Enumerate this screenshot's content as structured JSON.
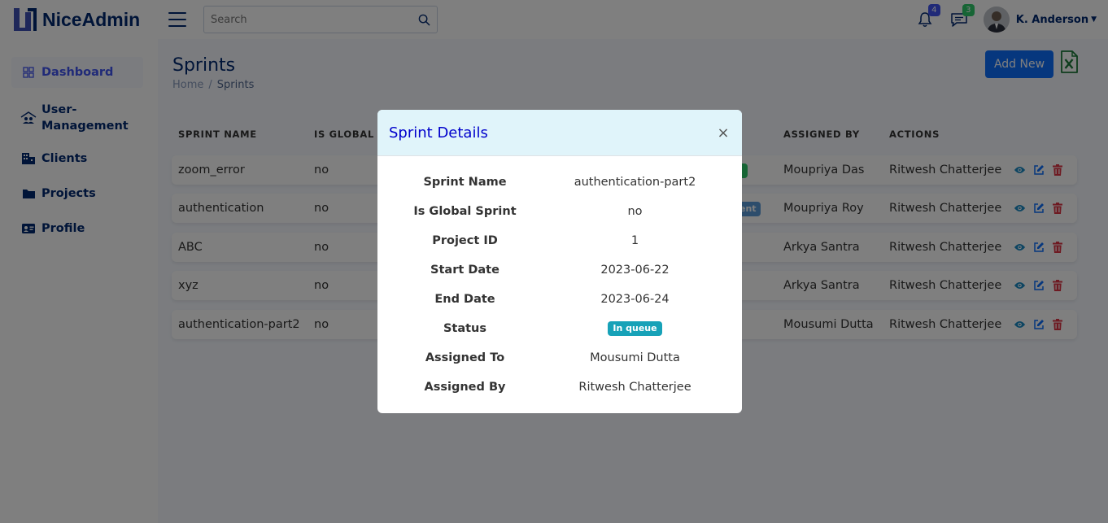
{
  "header": {
    "brand": "NiceAdmin",
    "search_placeholder": "Search",
    "notifications_count": "4",
    "messages_count": "3",
    "user_name": "K. Anderson"
  },
  "sidebar": {
    "items": [
      {
        "label": "Dashboard",
        "icon": "grid-icon",
        "active": true
      },
      {
        "label": "User-\nManagement",
        "icon": "user-management-icon"
      },
      {
        "label": "Clients",
        "icon": "building-icon"
      },
      {
        "label": "Projects",
        "icon": "folder-icon"
      },
      {
        "label": "Profile",
        "icon": "id-card-icon"
      }
    ]
  },
  "page": {
    "title": "Sprints",
    "breadcrumb": {
      "home": "Home",
      "separator": "/",
      "current": "Sprints"
    },
    "add_button": "Add New"
  },
  "table": {
    "headers": {
      "sprint_name": "SPRINT NAME",
      "is_global": "IS GLOBAL SP",
      "assigned_by": "ASSIGNED BY",
      "actions": "ACTIONS"
    },
    "rows": [
      {
        "name": "zoom_error",
        "global": "no",
        "assigned_to": "Moupriya Das",
        "assigned_by": "Ritwesh Chatterjee"
      },
      {
        "name": "authentication",
        "global": "no",
        "assigned_to": "Moupriya Roy",
        "assigned_by": "Ritwesh Chatterjee",
        "partial_badge": "ent"
      },
      {
        "name": "ABC",
        "global": "no",
        "assigned_to": "Arkya Santra",
        "assigned_by": "Ritwesh Chatterjee"
      },
      {
        "name": "xyz",
        "global": "no",
        "assigned_to": "Arkya Santra",
        "assigned_by": "Ritwesh Chatterjee"
      },
      {
        "name": "authentication-part2",
        "global": "no",
        "assigned_to": "Mousumi Dutta",
        "assigned_by": "Ritwesh Chatterjee"
      }
    ]
  },
  "modal": {
    "title": "Sprint Details",
    "close": "×",
    "fields": [
      {
        "label": "Sprint Name",
        "value": "authentication-part2"
      },
      {
        "label": "Is Global Sprint",
        "value": "no"
      },
      {
        "label": "Project ID",
        "value": "1"
      },
      {
        "label": "Start Date",
        "value": "2023-06-22"
      },
      {
        "label": "End Date",
        "value": "2023-06-24"
      },
      {
        "label": "Status",
        "value": "In queue",
        "badge": true
      },
      {
        "label": "Assigned To",
        "value": "Mousumi Dutta"
      },
      {
        "label": "Assigned By",
        "value": "Ritwesh Chatterjee"
      }
    ]
  },
  "colors": {
    "brand": "#012970",
    "primary": "#0d6efd",
    "status_badge": "#17a2b8",
    "view_icon": "#1a8ac4",
    "edit_icon": "#0d6efd",
    "delete_icon": "#dc3545",
    "excel": "#1d7a3a"
  }
}
